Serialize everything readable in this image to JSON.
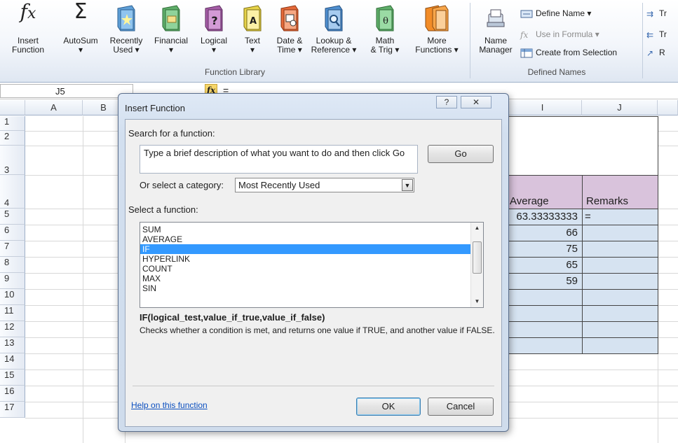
{
  "ribbon": {
    "function_library": {
      "group_label": "Function Library",
      "buttons": [
        {
          "label": "Insert\nFunction"
        },
        {
          "label": "AutoSum\n▾"
        },
        {
          "label": "Recently\nUsed ▾"
        },
        {
          "label": "Financial\n▾"
        },
        {
          "label": "Logical\n▾"
        },
        {
          "label": "Text\n▾"
        },
        {
          "label": "Date &\nTime ▾"
        },
        {
          "label": "Lookup &\nReference ▾"
        },
        {
          "label": "Math\n& Trig ▾"
        },
        {
          "label": "More\nFunctions ▾"
        }
      ]
    },
    "defined_names": {
      "group_label": "Defined Names",
      "name_manager": "Name\nManager",
      "define_name": "Define Name ▾",
      "use_in_formula": "Use in Formula ▾",
      "create_from_selection": "Create from Selection"
    },
    "partial": {
      "tr1": "Tr",
      "tr2": "Tr",
      "r": "R"
    }
  },
  "formula_bar": {
    "name_box": "J5",
    "fx": "fx",
    "content": "="
  },
  "sheet": {
    "columns": [
      "A",
      "B",
      "I",
      "J"
    ],
    "rows": [
      "1",
      "2",
      "3",
      "4",
      "5",
      "6",
      "7",
      "8",
      "9",
      "10",
      "11",
      "12",
      "13",
      "14",
      "15",
      "16",
      "17"
    ],
    "headers": {
      "average": "Average",
      "remarks": "Remarks"
    },
    "averages": [
      "63.33333333",
      "66",
      "75",
      "65",
      "59"
    ],
    "j5": "="
  },
  "dialog": {
    "title": "Insert Function",
    "help_btn": "?",
    "close_btn": "✕",
    "search_label": "Search for a function:",
    "search_value": "Type a brief description of what you want to do and then click Go",
    "go_button": "Go",
    "category_label": "Or select a category:",
    "category_value": "Most Recently Used",
    "select_label": "Select a function:",
    "functions": [
      "SUM",
      "AVERAGE",
      "IF",
      "HYPERLINK",
      "COUNT",
      "MAX",
      "SIN"
    ],
    "selected": "IF",
    "signature": "IF(logical_test,value_if_true,value_if_false)",
    "description": "Checks whether a condition is met, and returns one value if TRUE, and another value if FALSE.",
    "help_link": "Help on this function",
    "ok": "OK",
    "cancel": "Cancel"
  },
  "colors": {
    "header_fill": "#d9c3dc",
    "data_fill": "#d6e3f1",
    "selection": "#3399ff"
  }
}
